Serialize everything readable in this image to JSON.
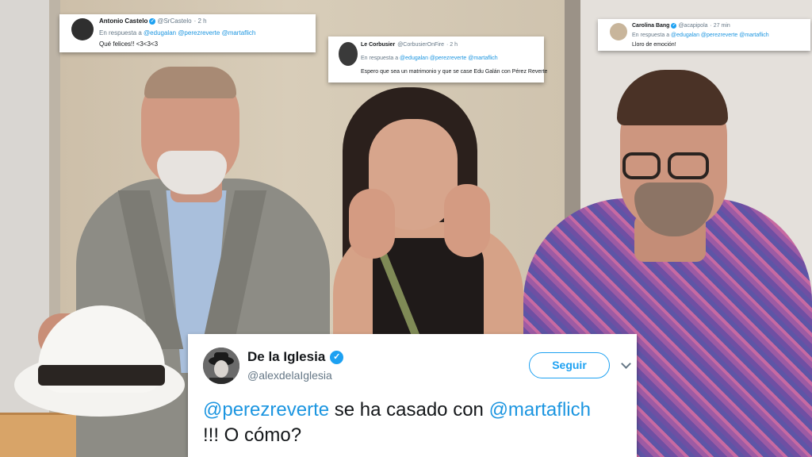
{
  "tweets": {
    "t1": {
      "name": "Antonio Castelo",
      "handle": "@SrCastelo",
      "time": "· 2 h",
      "reply_prefix": "En respuesta a",
      "reply_mentions": "@edugalan @perezreverte @martaflich",
      "text": "Qué felices!! <3<3<3"
    },
    "t2": {
      "name": "Le Corbusier",
      "handle": "@CorbusierOnFire",
      "time": "· 2 h",
      "reply_prefix": "En respuesta a",
      "reply_mentions": "@edugalan @perezreverte @martaflich",
      "text": "Espero que sea un matrimonio y que se case Edu Galán con Pérez Reverte"
    },
    "t3": {
      "name": "Carolina Bang",
      "handle": "@acapipola",
      "time": "· 27 min",
      "reply_prefix": "En respuesta a",
      "reply_mentions": "@edugalan @perezreverte @martaflich",
      "text": "Lloro de emoción!"
    },
    "main": {
      "name": "De la Iglesia",
      "handle": "@alexdelaIglesia",
      "follow_label": "Seguir",
      "mention1": "@perezreverte",
      "middle": " se ha casado con ",
      "mention2": "@martaflich",
      "line2": "!!! O cómo?"
    }
  },
  "colors": {
    "accent": "#1da1f2",
    "mention": "#1b95e0",
    "secondary_text": "#657786"
  },
  "icons": {
    "verified": "verified-badge-icon",
    "chevron": "chevron-down-icon"
  }
}
